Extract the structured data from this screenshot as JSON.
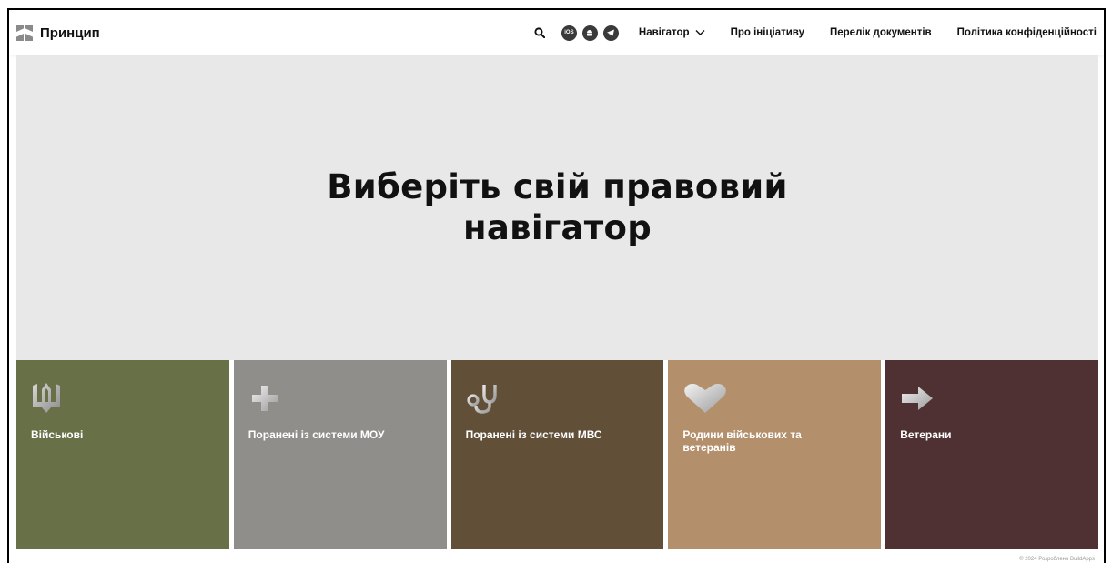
{
  "header": {
    "logo_text": "Принцип",
    "app_icons": [
      {
        "name": "ios-icon",
        "label": "iOS"
      },
      {
        "name": "android-icon",
        "label": ""
      },
      {
        "name": "telegram-icon",
        "label": ""
      }
    ],
    "nav": {
      "navigator": "Навігатор",
      "about": "Про ініціативу",
      "documents": "Перелік документів",
      "privacy": "Політика конфіденційності"
    }
  },
  "hero": {
    "title": "Виберіть свій правовий навігатор"
  },
  "tiles": [
    {
      "label": "Військові",
      "color": "#687048",
      "icon": "trident-icon"
    },
    {
      "label": "Поранені із системи МОУ",
      "color": "#8f8e8b",
      "icon": "cross-icon"
    },
    {
      "label": "Поранені із системи МВС",
      "color": "#614f38",
      "icon": "stethoscope-icon"
    },
    {
      "label": "Родини військових та ветеранів",
      "color": "#b48f6b",
      "icon": "heart-icon"
    },
    {
      "label": "Ветерани",
      "color": "#4f3133",
      "icon": "arrow-right-icon"
    }
  ],
  "footer": {
    "note": "© 2024 Розроблено BuildApps"
  }
}
